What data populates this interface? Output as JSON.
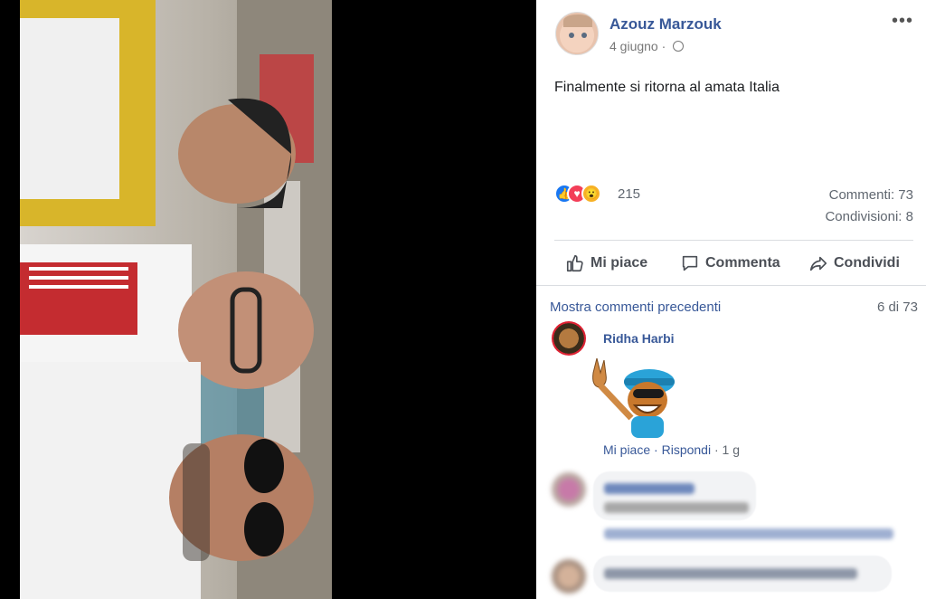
{
  "post": {
    "author": "Azouz Marzouk",
    "date": "4 giugno",
    "separator": "·",
    "text": "Finalmente si ritorna al amata Italia",
    "more_label": "•••"
  },
  "stats": {
    "reactions_count": "215",
    "comments": "Commenti: 73",
    "shares": "Condivisioni: 8"
  },
  "actions": {
    "like": "Mi piace",
    "comment": "Commenta",
    "share": "Condividi"
  },
  "comments_header": {
    "show_previous": "Mostra commenti precedenti",
    "pages": "6 di 73"
  },
  "comment": {
    "author": "Ridha Harbi",
    "like": "Mi piace",
    "reply": "Rispondi",
    "time": "1 g",
    "sep": "·"
  },
  "colors": {
    "link": "#385898",
    "like_blue": "#1877f2",
    "love_red": "#f33e58",
    "wow_yellow": "#f7b125"
  },
  "icons": [
    "globe-icon",
    "like-reaction-icon",
    "love-reaction-icon",
    "wow-reaction-icon",
    "thumbs-up-icon",
    "speech-bubble-icon",
    "share-arrow-icon"
  ]
}
